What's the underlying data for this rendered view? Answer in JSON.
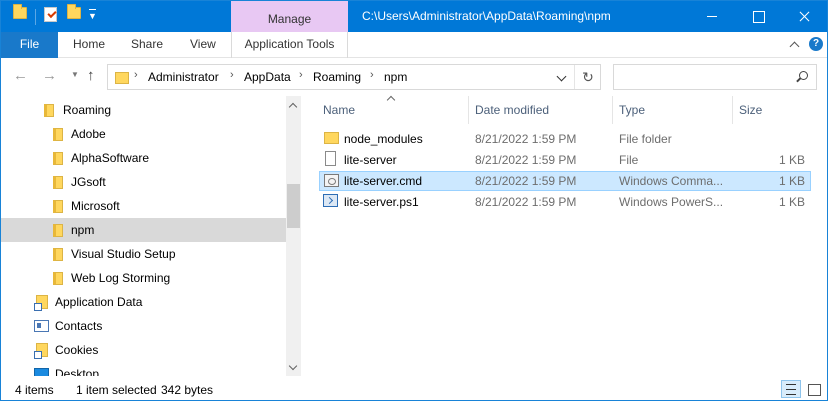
{
  "titlebar": {
    "manage_label": "Manage",
    "title": "C:\\Users\\Administrator\\AppData\\Roaming\\npm"
  },
  "ribbon": {
    "file": "File",
    "tabs": [
      "Home",
      "Share",
      "View"
    ],
    "app_tools": "Application Tools"
  },
  "address": {
    "crumbs": [
      "Administrator",
      "AppData",
      "Roaming",
      "npm"
    ]
  },
  "search": {
    "placeholder": ""
  },
  "tree": [
    {
      "label": "Roaming",
      "icon": "folder-icon"
    },
    {
      "label": "Adobe",
      "icon": "folder-icon"
    },
    {
      "label": "AlphaSoftware",
      "icon": "folder-icon"
    },
    {
      "label": "JGsoft",
      "icon": "folder-icon"
    },
    {
      "label": "Microsoft",
      "icon": "folder-icon"
    },
    {
      "label": "npm",
      "icon": "folder-icon",
      "selected": true
    },
    {
      "label": "Visual Studio Setup",
      "icon": "folder-icon"
    },
    {
      "label": "Web Log Storming",
      "icon": "folder-icon"
    },
    {
      "label": "Application Data",
      "icon": "shortcut-folder-icon"
    },
    {
      "label": "Contacts",
      "icon": "contacts-icon"
    },
    {
      "label": "Cookies",
      "icon": "shortcut-folder-icon"
    },
    {
      "label": "Desktop",
      "icon": "desktop-icon"
    }
  ],
  "columns": {
    "name": "Name",
    "date": "Date modified",
    "type": "Type",
    "size": "Size"
  },
  "files": [
    {
      "name": "node_modules",
      "date": "8/21/2022 1:59 PM",
      "type": "File folder",
      "size": "",
      "icon": "folder-icon"
    },
    {
      "name": "lite-server",
      "date": "8/21/2022 1:59 PM",
      "type": "File",
      "size": "1 KB",
      "icon": "file-icon"
    },
    {
      "name": "lite-server.cmd",
      "date": "8/21/2022 1:59 PM",
      "type": "Windows Comma...",
      "size": "1 KB",
      "icon": "cmd-file-icon",
      "selected": true
    },
    {
      "name": "lite-server.ps1",
      "date": "8/21/2022 1:59 PM",
      "type": "Windows PowerS...",
      "size": "1 KB",
      "icon": "powershell-file-icon"
    }
  ],
  "status": {
    "items": "4 items",
    "selected": "1 item selected",
    "bytes": "342 bytes"
  },
  "colors": {
    "titlebar": "#0078d7",
    "manage_tab": "#e8c8f3",
    "file_tab": "#1979ca",
    "selection": "#cce8ff",
    "tree_selection": "#d9d9d9"
  }
}
